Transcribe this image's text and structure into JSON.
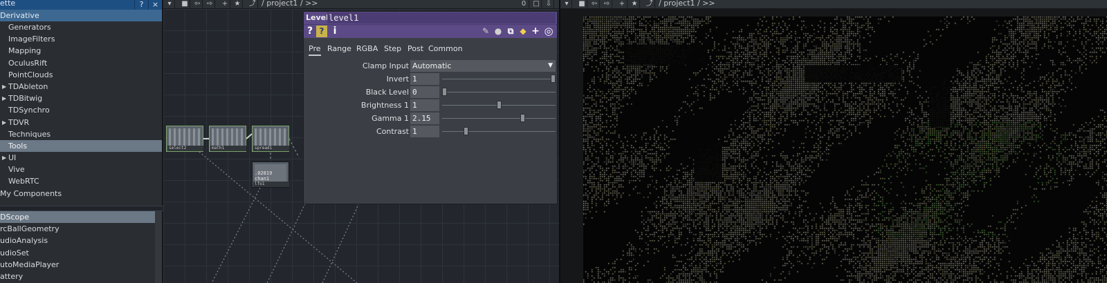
{
  "palette": {
    "title": "ette",
    "help_label": "?",
    "close_label": "×",
    "root_label": "Derivative",
    "items": [
      {
        "label": "Generators",
        "expandable": false
      },
      {
        "label": "ImageFilters",
        "expandable": false
      },
      {
        "label": "Mapping",
        "expandable": false
      },
      {
        "label": "OculusRift",
        "expandable": false
      },
      {
        "label": "PointClouds",
        "expandable": false
      },
      {
        "label": "TDAbleton",
        "expandable": true
      },
      {
        "label": "TDBitwig",
        "expandable": true
      },
      {
        "label": "TDSynchro",
        "expandable": false
      },
      {
        "label": "TDVR",
        "expandable": true
      },
      {
        "label": "Techniques",
        "expandable": false
      },
      {
        "label": "Tools",
        "expandable": false,
        "selected": true
      },
      {
        "label": "UI",
        "expandable": true
      },
      {
        "label": "Vive",
        "expandable": false
      },
      {
        "label": "WebRTC",
        "expandable": false
      }
    ],
    "my_components_label": "My Components",
    "components": [
      "DScope",
      "rcBallGeometry",
      "udioAnalysis",
      "udioSet",
      "utoMediaPlayer",
      "attery"
    ],
    "selected_component": "DScope"
  },
  "network": {
    "path": "/ project1 / >>",
    "counter": "0",
    "operators": [
      {
        "name": "select2"
      },
      {
        "name": "math1"
      },
      {
        "name": "spread1"
      },
      {
        "name": "lfo1",
        "value_text": ".02819 chan1"
      }
    ]
  },
  "params": {
    "op_type": "Level",
    "op_name": "level1",
    "tabs": [
      "Pre",
      "Range",
      "RGBA",
      "Step",
      "Post",
      "Common"
    ],
    "active_tab": "Pre",
    "rows": [
      {
        "label": "Clamp Input",
        "menu": "Automatic"
      },
      {
        "label": "Invert",
        "value": "1",
        "slider": 1.0
      },
      {
        "label": "Black Level",
        "value": "0",
        "slider": 0.0
      },
      {
        "label": "Brightness 1",
        "value": "1",
        "slider": 0.5
      },
      {
        "label": "Gamma 1",
        "value": "2.15",
        "slider": 0.72
      },
      {
        "label": "Contrast",
        "value": "1",
        "slider": 0.2
      }
    ],
    "icons": [
      "help-icon",
      "python-help-icon",
      "info-icon",
      "edit-icon",
      "comment-icon",
      "copy-icon",
      "python-icon",
      "add-icon",
      "viewer-icon"
    ]
  },
  "viewer": {
    "path": "/ project1 / >>"
  },
  "colors": {
    "palette_header": "#1e4f82",
    "param_header": "#5b4a86",
    "selection": "#6b7886"
  }
}
